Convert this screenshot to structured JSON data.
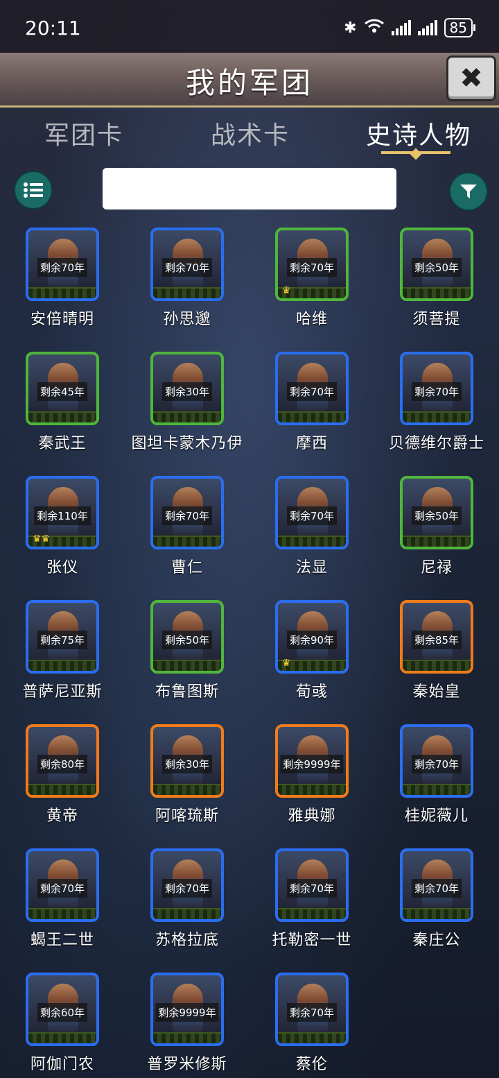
{
  "status_bar": {
    "time": "20:11",
    "battery": "85"
  },
  "header": {
    "title": "我的军团"
  },
  "tabs": [
    {
      "label": "军团卡",
      "active": false
    },
    {
      "label": "战术卡",
      "active": false
    },
    {
      "label": "史诗人物",
      "active": true
    }
  ],
  "search": {
    "value": "",
    "placeholder": ""
  },
  "cards": [
    {
      "name": "安倍晴明",
      "remain": "剩余70年",
      "frame": "blue",
      "crown": ""
    },
    {
      "name": "孙思邈",
      "remain": "剩余70年",
      "frame": "blue",
      "crown": ""
    },
    {
      "name": "哈维",
      "remain": "剩余70年",
      "frame": "green",
      "crown": "♛"
    },
    {
      "name": "须菩提",
      "remain": "剩余50年",
      "frame": "green",
      "crown": ""
    },
    {
      "name": "秦武王",
      "remain": "剩余45年",
      "frame": "green",
      "crown": ""
    },
    {
      "name": "图坦卡蒙木乃伊",
      "remain": "剩余30年",
      "frame": "green",
      "crown": ""
    },
    {
      "name": "摩西",
      "remain": "剩余70年",
      "frame": "blue",
      "crown": ""
    },
    {
      "name": "贝德维尔爵士",
      "remain": "剩余70年",
      "frame": "blue",
      "crown": ""
    },
    {
      "name": "张仪",
      "remain": "剩余110年",
      "frame": "blue",
      "crown": "♛♛"
    },
    {
      "name": "曹仁",
      "remain": "剩余70年",
      "frame": "blue",
      "crown": ""
    },
    {
      "name": "法显",
      "remain": "剩余70年",
      "frame": "blue",
      "crown": ""
    },
    {
      "name": "尼禄",
      "remain": "剩余50年",
      "frame": "green",
      "crown": ""
    },
    {
      "name": "普萨尼亚斯",
      "remain": "剩余75年",
      "frame": "blue",
      "crown": ""
    },
    {
      "name": "布鲁图斯",
      "remain": "剩余50年",
      "frame": "green",
      "crown": ""
    },
    {
      "name": "荀彧",
      "remain": "剩余90年",
      "frame": "blue",
      "crown": "♛"
    },
    {
      "name": "秦始皇",
      "remain": "剩余85年",
      "frame": "orange",
      "crown": ""
    },
    {
      "name": "黄帝",
      "remain": "剩余80年",
      "frame": "orange",
      "crown": ""
    },
    {
      "name": "阿喀琉斯",
      "remain": "剩余30年",
      "frame": "orange",
      "crown": ""
    },
    {
      "name": "雅典娜",
      "remain": "剩余9999年",
      "frame": "orange",
      "crown": ""
    },
    {
      "name": "桂妮薇儿",
      "remain": "剩余70年",
      "frame": "blue",
      "crown": ""
    },
    {
      "name": "蝎王二世",
      "remain": "剩余70年",
      "frame": "blue",
      "crown": ""
    },
    {
      "name": "苏格拉底",
      "remain": "剩余70年",
      "frame": "blue",
      "crown": ""
    },
    {
      "name": "托勒密一世",
      "remain": "剩余70年",
      "frame": "blue",
      "crown": ""
    },
    {
      "name": "秦庄公",
      "remain": "剩余70年",
      "frame": "blue",
      "crown": ""
    },
    {
      "name": "阿伽门农",
      "remain": "剩余60年",
      "frame": "blue",
      "crown": ""
    },
    {
      "name": "普罗米修斯",
      "remain": "剩余9999年",
      "frame": "blue",
      "crown": ""
    },
    {
      "name": "蔡伦",
      "remain": "剩余70年",
      "frame": "blue",
      "crown": ""
    }
  ]
}
